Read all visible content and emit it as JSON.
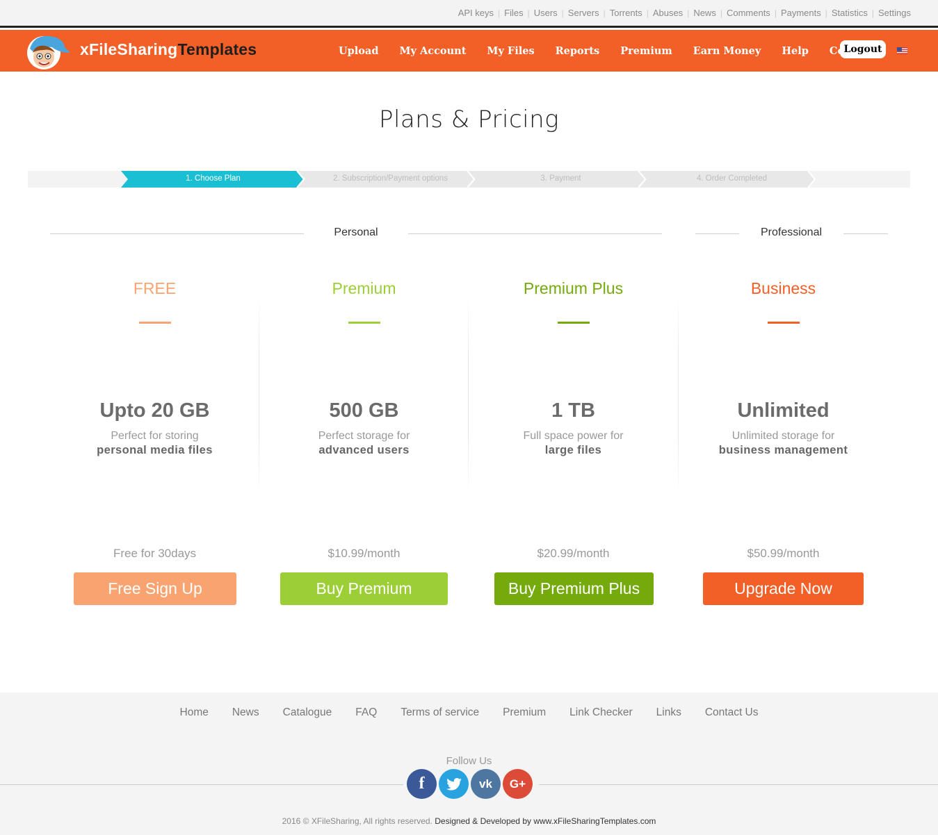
{
  "admin_nav": [
    "API keys",
    "Files",
    "Users",
    "Servers",
    "Torrents",
    "Abuses",
    "News",
    "Comments",
    "Payments",
    "Statistics",
    "Settings"
  ],
  "brand": {
    "name_light": "xFileSharing",
    "name_dark": "Templates"
  },
  "nav": [
    "Upload",
    "My Account",
    "My Files",
    "Reports",
    "Premium",
    "Earn Money",
    "Help",
    "Contact"
  ],
  "logout_label": "Logout",
  "page_title": "Plans & Pricing",
  "steps": [
    "1. Choose Plan",
    "2. Subscription/Payment options",
    "3. Payment",
    "4. Order Completed"
  ],
  "groups": {
    "personal": "Personal",
    "professional": "Professional"
  },
  "plans": [
    {
      "name": "FREE",
      "color": "#f9a470",
      "size": "Upto 20 GB",
      "desc": "Perfect for storing",
      "desc_bold": "personal media files",
      "price": "Free for 30days",
      "button": "Free Sign Up"
    },
    {
      "name": "Premium",
      "color": "#9bcf35",
      "size": "500 GB",
      "desc": "Perfect storage for",
      "desc_bold": "advanced users",
      "price": "$10.99/month",
      "button": "Buy Premium"
    },
    {
      "name": "Premium Plus",
      "color": "#74aa0c",
      "size": "1 TB",
      "desc": "Full space power for",
      "desc_bold": "large files",
      "price": "$20.99/month",
      "button": "Buy Premium Plus"
    },
    {
      "name": "Business",
      "color": "#f25f27",
      "size": "Unlimited",
      "desc": "Unlimited storage for",
      "desc_bold": "business management",
      "price": "$50.99/month",
      "button": "Upgrade Now"
    }
  ],
  "footer_links": [
    "Home",
    "News",
    "Catalogue",
    "FAQ",
    "Terms of service",
    "Premium",
    "Link Checker",
    "Links",
    "Contact Us"
  ],
  "follow_label": "Follow Us",
  "social": [
    {
      "icon": "facebook-icon",
      "glyph": "f",
      "color": "#3b5998"
    },
    {
      "icon": "twitter-icon",
      "glyph": "t",
      "color": "#29a3e0"
    },
    {
      "icon": "vk-icon",
      "glyph": "vk",
      "color": "#4d76a1"
    },
    {
      "icon": "google-plus-icon",
      "glyph": "G+",
      "color": "#dc4a38"
    }
  ],
  "copyright": {
    "text": "2016 © XFileSharing, All rights reserved.",
    "credit": "Designed & Developed by www.xFileSharingTemplates.com"
  },
  "colors": {
    "brand_orange": "#f25f27",
    "step_active": "#1bbfd3"
  }
}
